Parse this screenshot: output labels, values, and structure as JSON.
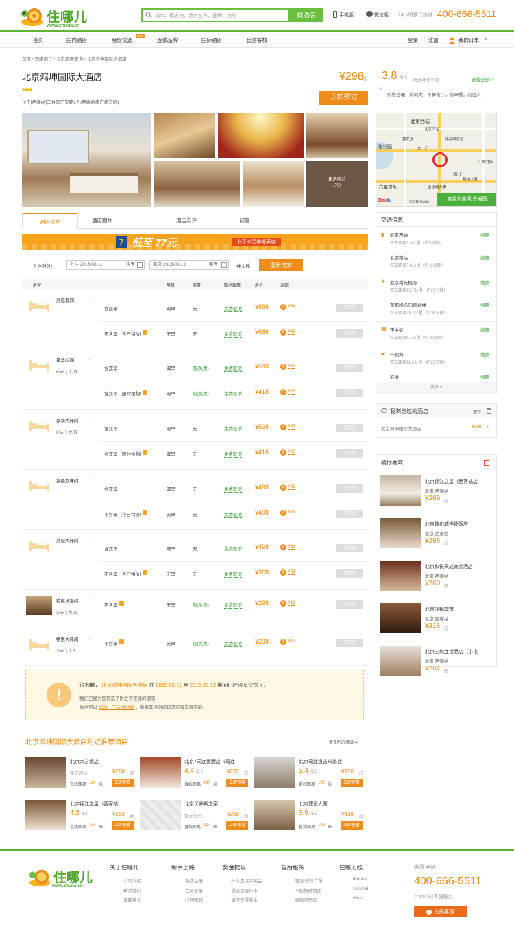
{
  "header": {
    "logo_text": "住哪儿",
    "logo_url": "www.zhuna.cn",
    "search_placeholder": "城市、标志物、酒店名称、品牌、地址",
    "search_button": "找酒店",
    "mobile": "手机版",
    "wechat": "微信版",
    "hotline_label": "24小时预订热线",
    "hotline": "400-666-5511"
  },
  "nav": {
    "items": [
      "首页",
      "国内酒店",
      "度假优选",
      "连锁品牌",
      "国际酒店",
      "民宿客栈"
    ],
    "badge": "new",
    "login": "登录",
    "register": "注册",
    "my_orders": "我的订单"
  },
  "breadcrumb": [
    "首页",
    "酒店预订",
    "北京酒店查询",
    "北京鸿坤国际大酒店"
  ],
  "hotel": {
    "name": "北京鸿坤国际大酒店",
    "address": "位于[西客站]丰台区广安路1号(西客站南广场东区)",
    "price": "¥298",
    "price_suffix": "起",
    "book_button": "立即预订",
    "more_photos": "更多照片",
    "photo_count": "(75)"
  },
  "review": {
    "score": "3.8",
    "out_of": "/5.0",
    "count": "来自25条评论",
    "view_all": "查看全部>>",
    "quote": "价格合理，房间大，不算贵了，有早餐。前台入"
  },
  "map": {
    "labels": [
      "北京西站",
      "北京西站",
      "池公园",
      "莲花池",
      "北京西客站",
      "东一门",
      "湾子",
      "广安门外",
      "六里桥东",
      "太平桥东里",
      "机械大厦"
    ],
    "button": "查看交通/街景地图",
    "copyright": "©2015 Baidu"
  },
  "tabs": [
    "酒店房型",
    "酒店图片",
    "酒店点评",
    "问答"
  ],
  "banner": {
    "num": "7",
    "text1": "低至",
    "text2": "77元",
    "text3": "七天全国连锁酒店"
  },
  "dates": {
    "label": "入住时段：",
    "checkin": "入住 2015-03-11",
    "today": "今天",
    "checkout": "离店 2015-03-12",
    "tomorrow": "明天",
    "nights": "共 1 晚",
    "search": "重新搜索"
  },
  "table_head": [
    "房型",
    "早餐",
    "宽带",
    "取消政策",
    "房价",
    "返现"
  ],
  "rooms": [
    {
      "name": "高级套间",
      "info": "",
      "rates": [
        {
          "plan": "含双早",
          "bf": "双早",
          "net": "无",
          "cancel": "免费取消",
          "price": "¥888",
          "cash": "¥54"
        },
        {
          "plan": "不含早（今日特价）",
          "bf": "无早",
          "net": "无",
          "cancel": "免费取消",
          "price": "¥688",
          "cash": "¥42"
        }
      ]
    },
    {
      "name": "豪华标间",
      "info": "60㎡ | 大/双",
      "rates": [
        {
          "plan": "含双早",
          "bf": "双早",
          "net": "有(免费)",
          "cancel": "免费取消",
          "price": "¥598",
          "cash": "¥37"
        },
        {
          "plan": "含双早（限时抢购）",
          "bf": "双早",
          "net": "有(免费)",
          "cancel": "免费取消",
          "price": "¥418",
          "cash": "¥26"
        }
      ]
    },
    {
      "name": "豪华大床间",
      "info": "60㎡ | 大/双",
      "rates": [
        {
          "plan": "含双早",
          "bf": "双早",
          "net": "无",
          "cancel": "免费取消",
          "price": "¥598",
          "cash": "¥37"
        },
        {
          "plan": "含双早（限时抢购）",
          "bf": "双早",
          "net": "无",
          "cancel": "免费取消",
          "price": "¥418",
          "cash": "¥26"
        }
      ]
    },
    {
      "name": "高级双床间",
      "info": "",
      "rates": [
        {
          "plan": "含双早",
          "bf": "双早",
          "net": "无",
          "cancel": "免费取消",
          "price": "¥498",
          "cash": "¥31"
        },
        {
          "plan": "不含早（今日特价）",
          "bf": "无早",
          "net": "无",
          "cancel": "免费取消",
          "price": "¥498",
          "cash": "¥31"
        }
      ]
    },
    {
      "name": "高级大床间",
      "info": "",
      "rates": [
        {
          "plan": "含双早",
          "bf": "双早",
          "net": "无",
          "cancel": "免费取消",
          "price": "¥498",
          "cash": "¥31"
        },
        {
          "plan": "不含早（今日特价）",
          "bf": "无早",
          "net": "无",
          "cancel": "免费取消",
          "price": "¥368",
          "cash": "¥23"
        }
      ]
    },
    {
      "name": "特惠标准间",
      "info": "30㎡ | 大/双",
      "rates": [
        {
          "plan": "不含早",
          "bf": "无早",
          "net": "有(免费)",
          "cancel": "免费取消",
          "price": "¥298",
          "cash": "¥19"
        }
      ]
    },
    {
      "name": "特惠大床间",
      "info": "30㎡ | 大/5",
      "rates": [
        {
          "plan": "不含早",
          "bf": "无早",
          "net": "有(免费)",
          "cancel": "免费取消",
          "price": "¥298",
          "cash": "¥19"
        }
      ]
    }
  ],
  "book_btn": "已订完",
  "notice": {
    "p1": "很抱歉，",
    "hotel": "北京鸿坤国际大酒店",
    "p2": "在",
    "d1": "2015-03-11",
    "p3": "至",
    "d2": "2015-03-12",
    "p4": "期间已经没有空房了。",
    "line2": "我们已经为您筛选了附近有空房的酒店",
    "line3a": "你也可以",
    "line3b": "修改一下入住时间",
    "line3c": "，看看其他时间该酒店有没有空房。"
  },
  "nearby": {
    "title_hotel": "北京鸿坤国际大酒店",
    "title_rest": "附近推荐酒店",
    "more": "更多附近酒店>>",
    "dist_label": "直线距离",
    "unit": "米",
    "button": "立即查看",
    "suffix": "起",
    "items": [
      {
        "name": "北京大方饭店",
        "score": "暂无评分",
        "outof": "",
        "price": "¥298",
        "dist": "114"
      },
      {
        "name": "北京7天连锁酒店（马连",
        "score": "4.4",
        "outof": "/5.0",
        "price": "¥272",
        "dist": "147"
      },
      {
        "name": "北京马连道吉兴旅社",
        "score": "3.4",
        "outof": "/5.0",
        "price": "¥150",
        "dist": "152"
      },
      {
        "name": "北京锦江之星（西客站",
        "score": "4.2",
        "outof": "/5.0",
        "price": "¥269",
        "dist": "154"
      },
      {
        "name": "北京优豪斯之家",
        "score": "暂无评分",
        "outof": "",
        "price": "¥258",
        "dist": "197"
      },
      {
        "name": "北京建设大厦",
        "score": "3.9",
        "outof": "/5.0",
        "price": "¥418",
        "dist": "198"
      }
    ]
  },
  "traffic": {
    "title": "交通信息",
    "route": "线路",
    "groups": [
      {
        "items": [
          {
            "name": "北京西站",
            "dist": "驾车距离3.3公里（约5分钟）"
          },
          {
            "name": "北京南站",
            "dist": "驾车距离7.6公里（约11分钟）"
          }
        ]
      },
      {
        "items": [
          {
            "name": "北京南苑机场",
            "dist": "驾车距离16.7公里（约27分钟）"
          },
          {
            "name": "首都机场T3航站楼",
            "dist": "驾车距离38.1公里（约36分钟）"
          }
        ]
      },
      {
        "items": [
          {
            "name": "市中心",
            "dist": "驾车距离6.1公里（约16分钟）"
          }
        ]
      },
      {
        "items": [
          {
            "name": "什刹海",
            "dist": "驾车距离11.2公里（约25分钟）"
          },
          {
            "name": "鼓楼",
            "dist": "驾车距离13.3公里（约26分钟）"
          }
        ]
      }
    ],
    "more": "更多"
  },
  "viewed": {
    "title": "我浏览过的酒店",
    "clear": "清空",
    "hotel": "北京鸿坤国际大酒店",
    "price": "¥298"
  },
  "guess": {
    "title": "猜你喜欢",
    "suffix": "起",
    "items": [
      {
        "name": "北京锦江之星（西客站店",
        "area": "北京 西客站",
        "price": "¥269"
      },
      {
        "name": "北京瑞尔威连锁饭店",
        "area": "北京 西客站",
        "price": "¥268"
      },
      {
        "name": "北京和悦天成商务酒店",
        "area": "北京 西客站",
        "price": "¥260"
      },
      {
        "name": "北京沙锅宾馆",
        "area": "北京 西客站",
        "price": "¥318"
      },
      {
        "name": "北京三和连锁酒店（小屯",
        "area": "北京 西客站",
        "price": "¥264"
      }
    ]
  },
  "footer": {
    "cols": [
      {
        "title": "关于住哪儿",
        "links": [
          "公司介绍",
          "联系我们",
          "诚聘英才"
        ]
      },
      {
        "title": "新手上路",
        "links": [
          "免费注册",
          "会员登录",
          "找回密码"
        ]
      },
      {
        "title": "奖金提现",
        "links": [
          "什么是点评奖金",
          "提现到银行卡",
          "如何获得奖金"
        ]
      },
      {
        "title": "售后服务",
        "links": [
          "取消/修改订单",
          "不能按时到达",
          "到酒店无房"
        ]
      },
      {
        "title": "住哪无线",
        "links": [
          "iPhone",
          "Android",
          "Wap"
        ]
      }
    ],
    "phone_label": "客服电话",
    "phone": "400-666-5511",
    "service": "7*24小时客服服务",
    "online": "在线客服"
  }
}
